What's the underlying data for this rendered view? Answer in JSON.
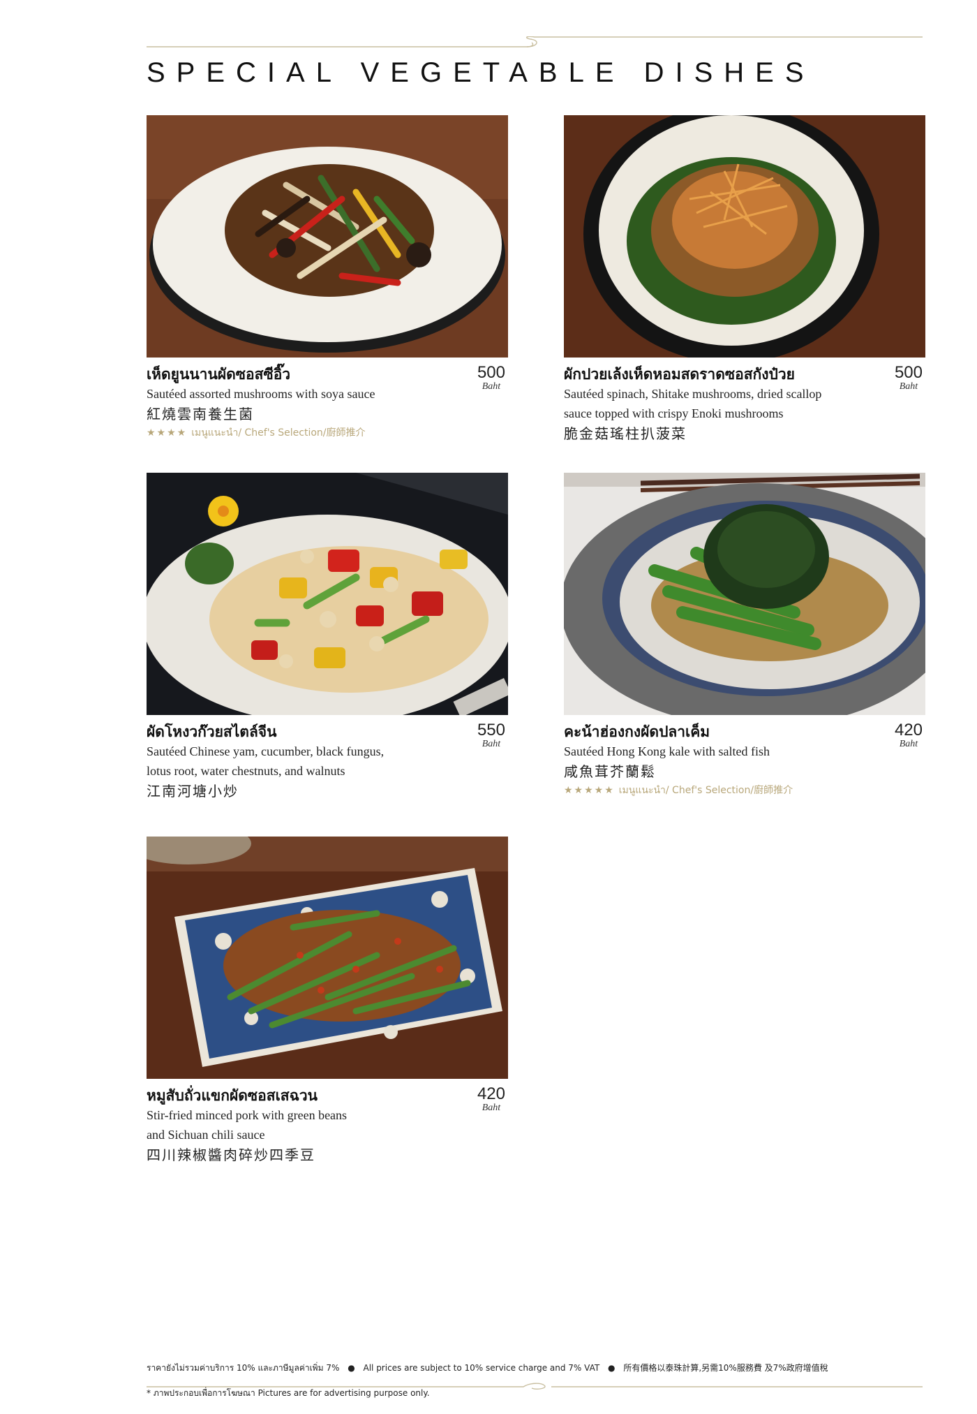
{
  "title": "SPECIAL VEGETABLE DISHES",
  "accent_color": "#b8a77a",
  "items": [
    {
      "thai": "เห็ดยูนนานผัดซอสซีอิ๊ว",
      "en1": "Sautéed assorted mushrooms with soya sauce",
      "en2": "",
      "zh": "紅燒雲南養生菌",
      "price": "500",
      "unit": "Baht",
      "chef_stars": "★★★★",
      "chef_text": "เมนูแนะนำ/ Chef's Selection/廚師推介"
    },
    {
      "thai": "ผักปวยเล้งเห็ดหอมสดราดซอสกังป๋วย",
      "en1": "Sautéed spinach, Shitake mushrooms, dried scallop",
      "en2": "sauce topped with crispy Enoki mushrooms",
      "zh": "脆金菇瑤柱扒菠菜",
      "price": "500",
      "unit": "Baht"
    },
    {
      "thai": "ผัดโหงวก๊วยสไตล์จีน",
      "en1": "Sautéed Chinese yam, cucumber, black fungus,",
      "en2": "lotus root, water chestnuts, and walnuts",
      "zh": "江南河塘小炒",
      "price": "550",
      "unit": "Baht"
    },
    {
      "thai": "คะน้าฮ่องกงผัดปลาเค็ม",
      "en1": "Sautéed Hong Kong kale with salted fish",
      "en2": "",
      "zh": "咸魚茸芥蘭鬆",
      "price": "420",
      "unit": "Baht",
      "chef_stars": "★★★★★",
      "chef_text": "เมนูแนะนำ/ Chef's Selection/廚師推介"
    },
    {
      "thai": "หมูสับถั่วแขกผัดซอสเสฉวน",
      "en1": "Stir-fried minced pork with green beans",
      "en2": "and Sichuan chili sauce",
      "zh": "四川辣椒醬肉碎炒四季豆",
      "price": "420",
      "unit": "Baht"
    }
  ],
  "footer": {
    "thai_note": "ราคายังไม่รวมค่าบริการ 10% และภาษีมูลค่าเพิ่ม 7%",
    "en_note": "All prices are subject to 10% service charge and 7% VAT",
    "zh_note": "所有價格以泰珠計算,另需10%服務費 及7%政府增值稅",
    "bullet": "●",
    "pictures_note": "* ภาพประกอบเพื่อการโฆษณา Pictures are for advertising purpose only."
  }
}
